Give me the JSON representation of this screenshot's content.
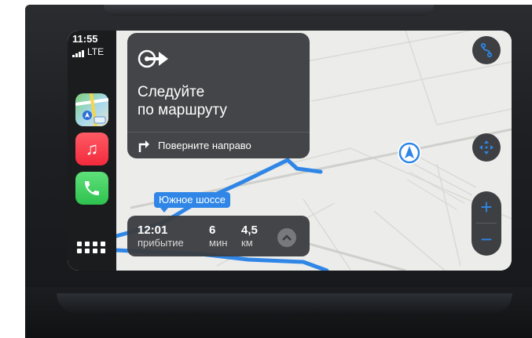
{
  "status": {
    "time": "11:55",
    "network": "LTE"
  },
  "dock": {
    "apps": [
      "maps-app-icon",
      "music-app-icon",
      "phone-app-icon"
    ],
    "grid_button": "app-grid-icon"
  },
  "maneuver": {
    "icon": "follow-route-arrow-icon",
    "title_line1": "Следуйте",
    "title_line2": "по маршруту",
    "next_icon": "turn-right-icon",
    "next_instruction": "Поверните направо"
  },
  "road_label": "Южное шоссе",
  "eta": {
    "arrival_value": "12:01",
    "arrival_label": "прибытие",
    "duration_value": "6",
    "duration_label": "мин",
    "distance_value": "4,5",
    "distance_label": "км",
    "expand_icon": "chevron-up-icon"
  },
  "controls": {
    "route_overview_icon": "route-overview-icon",
    "pan_icon": "pan-arrows-icon",
    "zoom_in_label": "+",
    "zoom_out_label": "−"
  },
  "colors": {
    "accent": "#2f86e6",
    "card_bg": "#3a3c3f",
    "map_bg": "#ececea",
    "music_red": "#f22a3c",
    "phone_green": "#2ec24e"
  }
}
